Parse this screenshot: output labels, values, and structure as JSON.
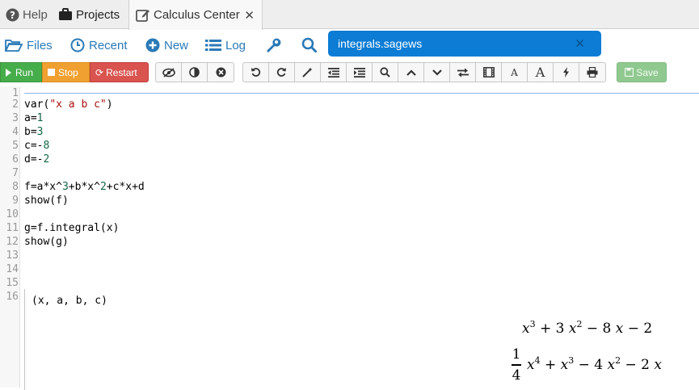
{
  "top_tabs": {
    "help": "Help",
    "projects": "Projects",
    "active": "Calculus Center",
    "close": "✕"
  },
  "file_bar": {
    "files": "Files",
    "recent": "Recent",
    "new": "New",
    "log": "Log",
    "open_file": "integrals.sagews",
    "close": "✕"
  },
  "toolbar": {
    "run": "Run",
    "stop": "Stop",
    "restart": "Restart",
    "save": "Save",
    "font_small": "A",
    "font_large": "A"
  },
  "editor": {
    "line_numbers": [
      "1",
      "2",
      "3",
      "4",
      "5",
      "6",
      "7",
      "8",
      "9",
      "10",
      "11",
      "12",
      "13",
      "14",
      "15",
      "16"
    ],
    "lines": {
      "l2a": "var(",
      "l2s": "\"x a b c\"",
      "l2b": ")",
      "l3a": "a=",
      "l3n": "1",
      "l4a": "b=",
      "l4n": "3",
      "l5a": "c=-",
      "l5n": "8",
      "l6a": "d=-",
      "l6n": "2",
      "l8a": "f=a*x^",
      "l8n1": "3",
      "l8b": "+b*x^",
      "l8n2": "2",
      "l8c": "+c*x+d",
      "l9": "show(f)",
      "l11": "g=f.integral(x)",
      "l12": "show(g)"
    }
  },
  "output": {
    "tuple_text": "(x, a, b, c)",
    "f_expr": {
      "t1": "x",
      "e1": "3",
      "op1": " + 3 ",
      "t2": "x",
      "e2": "2",
      "op2": " − 8 ",
      "t3": "x",
      "op3": " − 2"
    },
    "g_expr": {
      "num": "1",
      "den": "4",
      "t1": "x",
      "e1": "4",
      "op1": " + ",
      "t2": "x",
      "e2": "3",
      "op2": " − 4 ",
      "t3": "x",
      "e3": "2",
      "op3": " − 2 ",
      "t4": "x"
    }
  },
  "colors": {
    "run": "#46ad4b",
    "stop": "#f0a030",
    "restart": "#d9534f",
    "file_tab": "#0c7cd5",
    "save": "#90c990",
    "link": "#2a7ab8"
  }
}
